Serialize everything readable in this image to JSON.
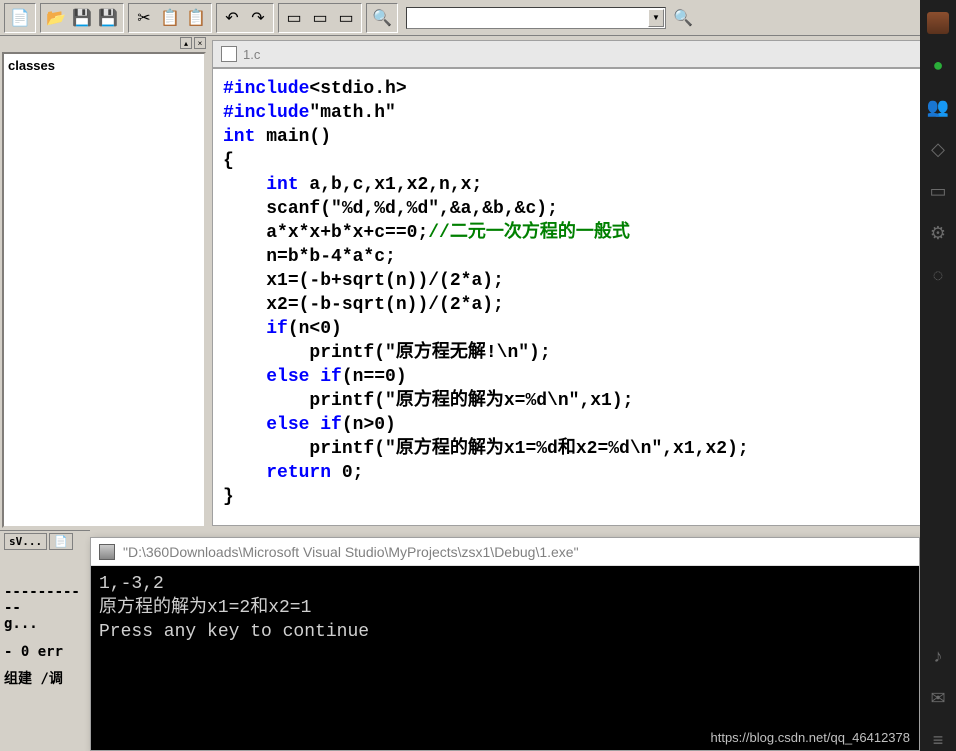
{
  "toolbar": {
    "buttons": [
      "new",
      "open",
      "save",
      "save-all",
      "cut",
      "copy",
      "paste",
      "undo",
      "redo",
      "window-list",
      "window-tile",
      "window-stack",
      "find",
      "find-in-files"
    ],
    "dropdown_value": ""
  },
  "side_panel": {
    "label": "classes"
  },
  "editor": {
    "file_tab": "1.c",
    "code": {
      "l1_kw": "#include",
      "l1_rest": "<stdio.h>",
      "l2_kw": "#include",
      "l2_rest": "\"math.h\"",
      "l3_kw": "int",
      "l3_rest": " main()",
      "l4": "{",
      "l5_kw": "int",
      "l5_rest": " a,b,c,x1,x2,n,x;",
      "l6": "scanf(\"%d,%d,%d\",&a,&b,&c);",
      "l7_expr": "a*x*x+b*x+c==0;",
      "l7_comment": "//二元一次方程的一般式",
      "l8": "n=b*b-4*a*c;",
      "l9": "x1=(-b+sqrt(n))/(2*a);",
      "l10": "x2=(-b-sqrt(n))/(2*a);",
      "l11_kw": "if",
      "l11_rest": "(n<0)",
      "l12": "printf(\"原方程无解!\\n\");",
      "l13_kw": "else if",
      "l13_rest": "(n==0)",
      "l14": "printf(\"原方程的解为x=%d\\n\",x1);",
      "l15_kw": "else if",
      "l15_rest": "(n>0)",
      "l16": "printf(\"原方程的解为x1=%d和x2=%d\\n\",x1,x2);",
      "l17_kw": "return",
      "l17_rest": " 0;",
      "l18": "}"
    }
  },
  "bottom_panel": {
    "tab1": "sV...",
    "tab2": "📄",
    "line1": "-----------",
    "line2": "g...",
    "line3": "- 0 err",
    "footer_tab1": "组建",
    "footer_tab2": "调"
  },
  "console": {
    "title": "\"D:\\360Downloads\\Microsoft Visual Studio\\MyProjects\\zsx1\\Debug\\1.exe\"",
    "line1": "1,-3,2",
    "line2": "原方程的解为x1=2和x2=1",
    "line3": "Press any key to continue"
  },
  "watermark": "https://blog.csdn.net/qq_46412378",
  "dock_icons": [
    "avatar",
    "chat",
    "people",
    "cube",
    "folder",
    "settings",
    "misc",
    "music",
    "mail",
    "menu"
  ]
}
